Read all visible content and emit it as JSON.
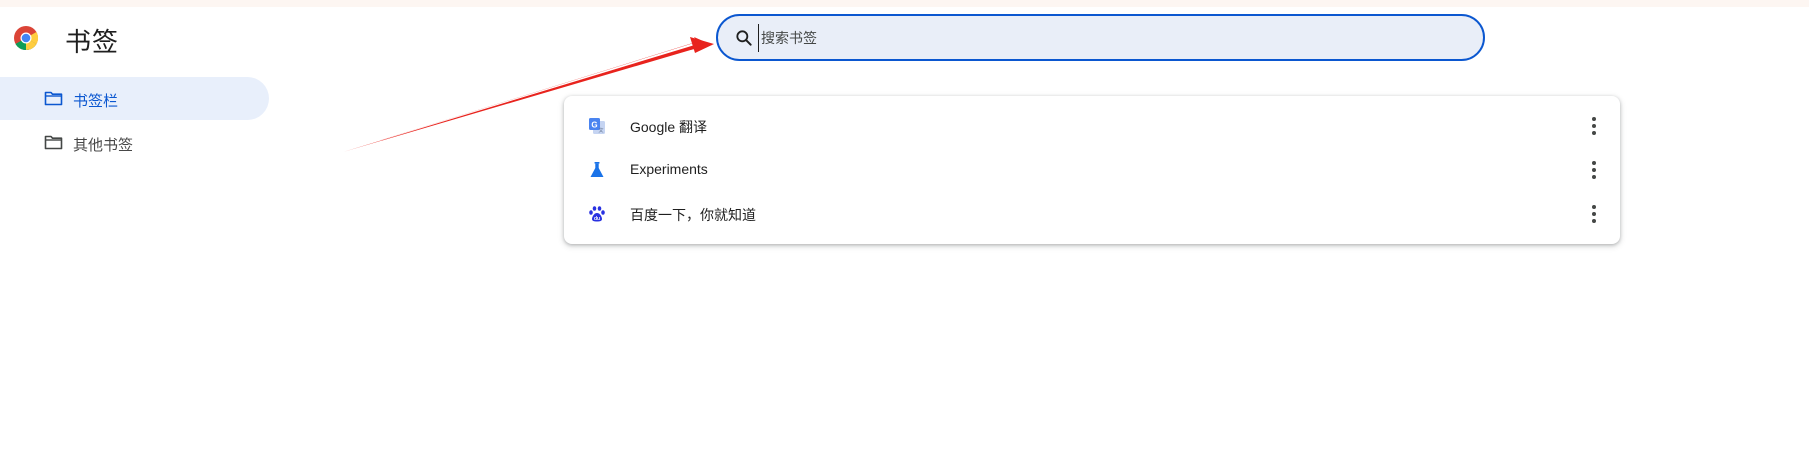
{
  "app": {
    "title": "书签",
    "logo_icon": "chrome-logo-icon"
  },
  "search": {
    "placeholder": "搜索书签",
    "value": "",
    "icon": "search-icon"
  },
  "sidebar": {
    "items": [
      {
        "label": "书签栏",
        "icon": "folder-icon",
        "active": true
      },
      {
        "label": "其他书签",
        "icon": "folder-icon",
        "active": false
      }
    ]
  },
  "bookmarks": [
    {
      "title": "Google 翻译",
      "icon": "google-translate-icon"
    },
    {
      "title": "Experiments",
      "icon": "flask-icon"
    },
    {
      "title": "百度一下，你就知道",
      "icon": "baidu-paw-icon"
    }
  ],
  "colors": {
    "accent": "#0b57d0",
    "annotation_arrow": "#e8231d",
    "active_bg": "#e8effb",
    "search_bg": "#e9eef8"
  }
}
